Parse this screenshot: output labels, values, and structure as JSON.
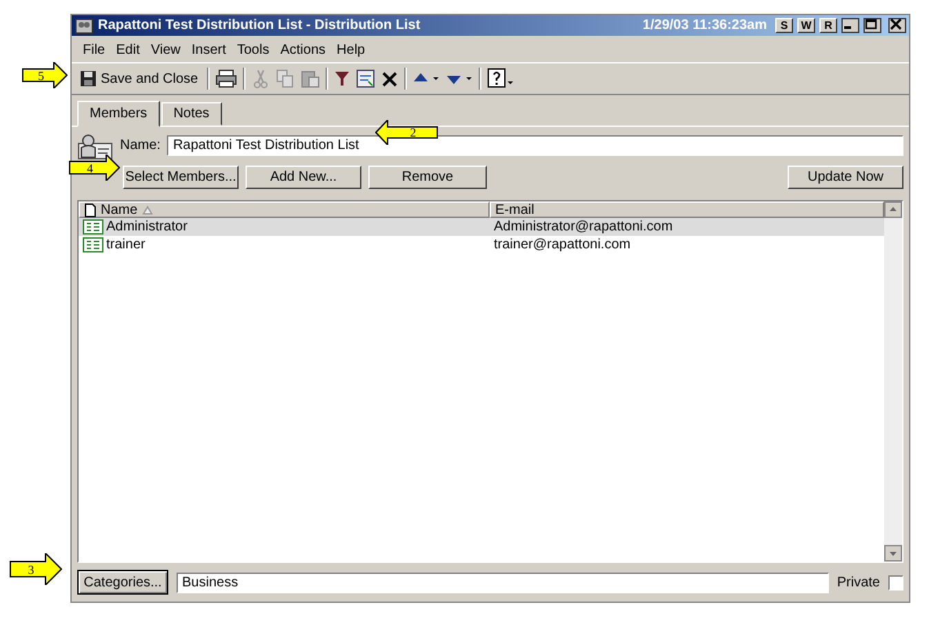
{
  "window": {
    "title": "Rapattoni Test Distribution List - Distribution List",
    "clock": "1/29/03 11:36:23am",
    "title_buttons": [
      "S",
      "W",
      "R"
    ]
  },
  "menu": [
    "File",
    "Edit",
    "View",
    "Insert",
    "Tools",
    "Actions",
    "Help"
  ],
  "toolbar": {
    "save_label": "Save and Close"
  },
  "tabs": [
    {
      "label": "Members",
      "selected": true
    },
    {
      "label": "Notes",
      "selected": false
    }
  ],
  "name_field": {
    "label": "Name:",
    "value": "Rapattoni Test Distribution List"
  },
  "buttons": [
    "Select Members...",
    "Add New...",
    "Remove"
  ],
  "update_button": "Update Now",
  "table": {
    "columns": [
      "Name",
      "E-mail"
    ],
    "rows": [
      {
        "name": "Administrator",
        "email": "Administrator@rapattoni.com",
        "selected": true
      },
      {
        "name": "trainer",
        "email": "trainer@rapattoni.com",
        "selected": false
      }
    ]
  },
  "categories": {
    "button": "Categories...",
    "value": "Business"
  },
  "private": {
    "label": "Private",
    "checked": false
  },
  "callouts": [
    {
      "number": "5",
      "kind": "right"
    },
    {
      "number": "2",
      "kind": "left"
    },
    {
      "number": "4",
      "kind": "right"
    },
    {
      "number": "3",
      "kind": "right"
    }
  ]
}
